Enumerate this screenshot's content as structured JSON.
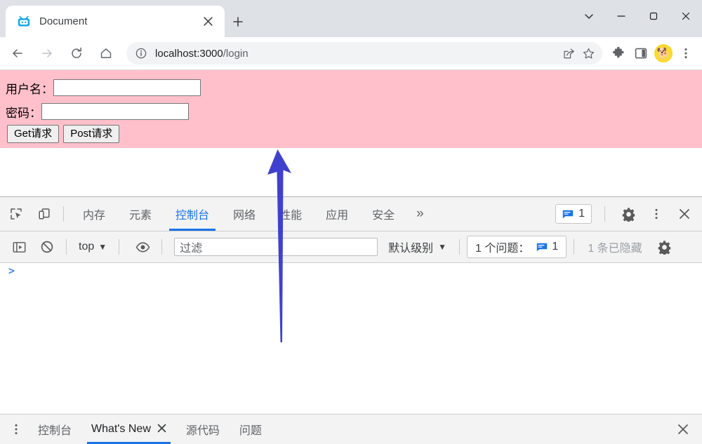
{
  "browser": {
    "window_controls": {
      "tab_search_label": "⌄",
      "minimize_label": "—",
      "maximize_label": "▢",
      "close_label": "✕"
    },
    "tab": {
      "title": "Document",
      "favicon": "tv-robot-icon",
      "close_label": "✕"
    },
    "new_tab_label": "+",
    "nav": {
      "back_label": "←",
      "forward_label": "→",
      "reload_label": "⟳",
      "home_label": "⌂"
    },
    "omnibox": {
      "info_icon": "site-info-icon",
      "url_host": "localhost:3000",
      "url_path": "/login",
      "share_icon": "share-icon",
      "bookmark_icon": "star-icon"
    },
    "toolbar_icons": {
      "extensions": "puzzle-icon",
      "side_panel": "side-panel-icon",
      "profile": "corgi-avatar",
      "profile_glyph": "🐕",
      "menu": "three-dot-menu-icon"
    }
  },
  "page": {
    "background_color": "#ffc0cb",
    "username": {
      "label": "用户名：",
      "value": "",
      "placeholder": ""
    },
    "password": {
      "label": "密码：",
      "value": "",
      "placeholder": ""
    },
    "buttons": {
      "get": "Get请求",
      "post": "Post请求"
    }
  },
  "devtools": {
    "left_icons": {
      "inspect": "inspect-element-icon",
      "device": "device-toolbar-icon"
    },
    "tabs": [
      {
        "label": "内存",
        "active": false
      },
      {
        "label": "元素",
        "active": false
      },
      {
        "label": "控制台",
        "active": true
      },
      {
        "label": "网络",
        "active": false
      },
      {
        "label": "性能",
        "active": false
      },
      {
        "label": "应用",
        "active": false
      },
      {
        "label": "安全",
        "active": false
      }
    ],
    "overflow_label": "»",
    "message_badge": {
      "icon": "message-icon",
      "count": "1"
    },
    "settings_icon": "gear-icon",
    "more_icon": "three-dot-menu-icon",
    "close_icon": "close-icon",
    "console_toolbar": {
      "sidebar_toggle_icon": "console-sidebar-icon",
      "clear_icon": "clear-console-icon",
      "context": "top",
      "context_caret": "▼",
      "eye_icon": "live-expression-icon",
      "filter_placeholder": "过滤",
      "filter_value": "",
      "level": "默认级别",
      "level_caret": "▼",
      "issues_label": "1 个问题：",
      "issues_count": "1",
      "hidden_label": "1 条已隐藏",
      "settings_icon": "gear-icon"
    },
    "console_prompt": ">",
    "drawer": {
      "menu_icon": "three-dot-menu-icon",
      "tabs": [
        {
          "label": "控制台",
          "active": false,
          "closable": false
        },
        {
          "label": "What's New",
          "active": true,
          "closable": true
        },
        {
          "label": "源代码",
          "active": false,
          "closable": false
        },
        {
          "label": "问题",
          "active": false,
          "closable": false
        }
      ],
      "close_label": "✕",
      "tab_close_label": "✕"
    }
  },
  "annotation": {
    "arrow_color": "#4040cf",
    "direction": "up",
    "points_to": "page-form-area"
  }
}
